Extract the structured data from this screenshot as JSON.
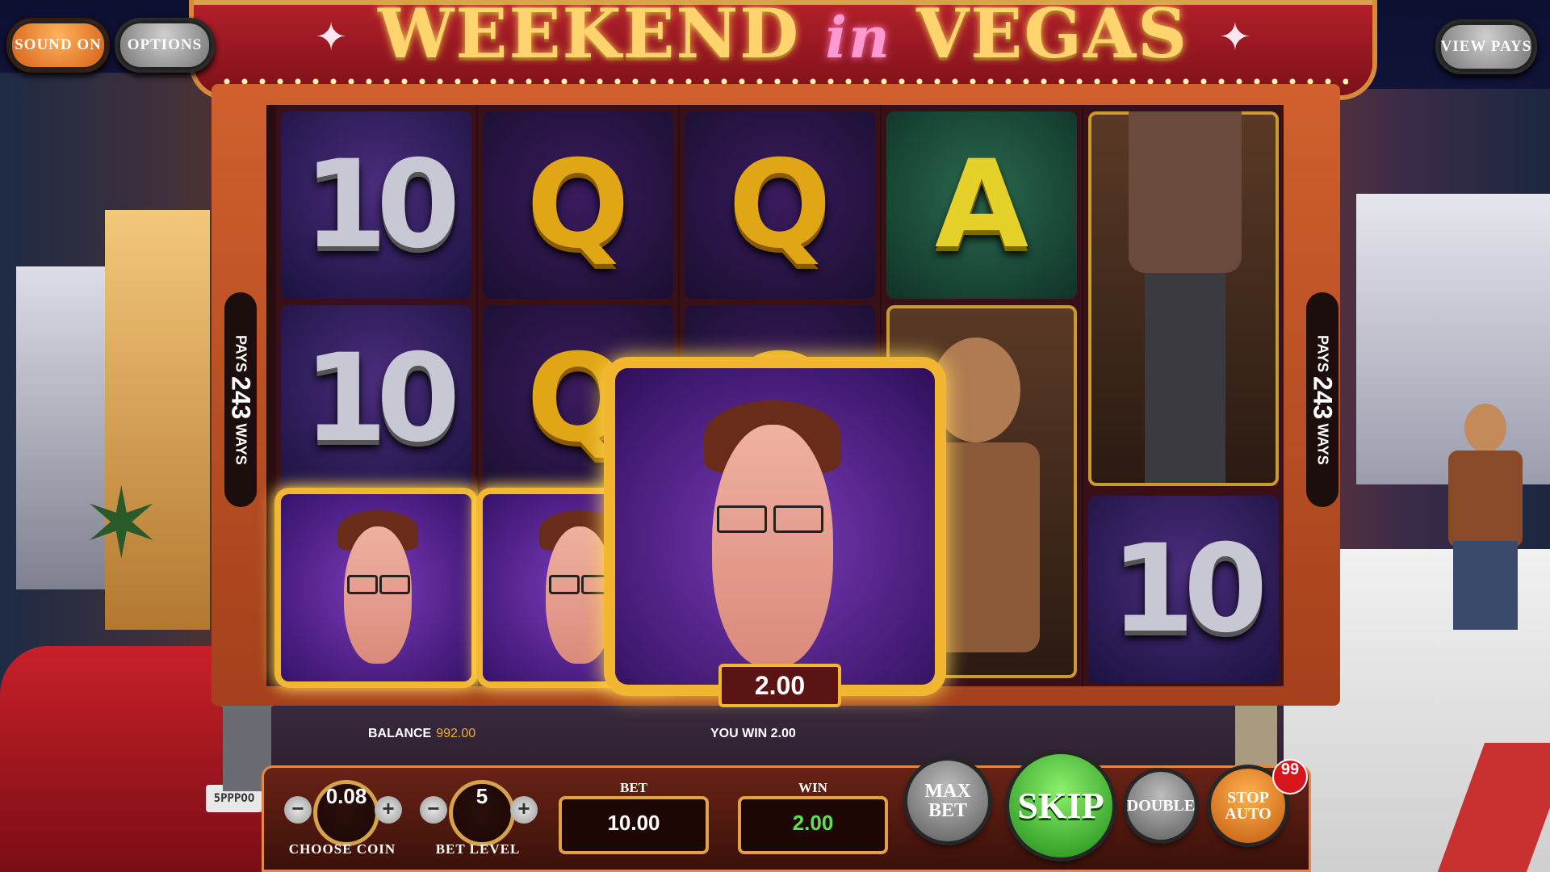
{
  "game": {
    "title_left": "WEEKEND",
    "title_mid": "in",
    "title_right": "VEGAS"
  },
  "top_buttons": {
    "sound": "SOUND ON",
    "options": "OPTIONS",
    "view_pays": "VIEW PAYS"
  },
  "pays_badge": {
    "pays": "PAYS",
    "ways_count": "243",
    "ways": "WAYS"
  },
  "reels": {
    "reel1": [
      "10",
      "10",
      "nerd"
    ],
    "reel2": [
      "Q",
      "Q",
      "nerd"
    ],
    "reel3": [
      "Q",
      "Q",
      "nerd"
    ],
    "reel4": [
      "A",
      "bearded-man",
      "bearded-man"
    ],
    "reel5": [
      "man-in-jacket",
      "man-in-jacket",
      "10"
    ],
    "win_amount_tag": "2.00"
  },
  "info_bar": {
    "balance_label": "BALANCE",
    "balance_value": "992.00",
    "you_win_label": "YOU WIN",
    "you_win_value": "2.00"
  },
  "controls": {
    "coin_value": "0.08",
    "coin_label": "CHOOSE COIN",
    "bet_level_value": "5",
    "bet_level_label": "BET LEVEL",
    "minus": "−",
    "plus": "+",
    "bet_label": "BET",
    "bet_value": "10.00",
    "win_label": "WIN",
    "win_value": "2.00",
    "max_bet": "MAX BET",
    "skip": "SKIP",
    "double": "DOUBLE",
    "stop_auto": "STOP AUTO",
    "auto_spins_left": "99"
  },
  "scenery": {
    "license_plate": "5PPPOO"
  },
  "colors": {
    "accent_gold": "#f2b631",
    "win_green": "#5ee34a",
    "balance_orange": "#f0a93a"
  }
}
